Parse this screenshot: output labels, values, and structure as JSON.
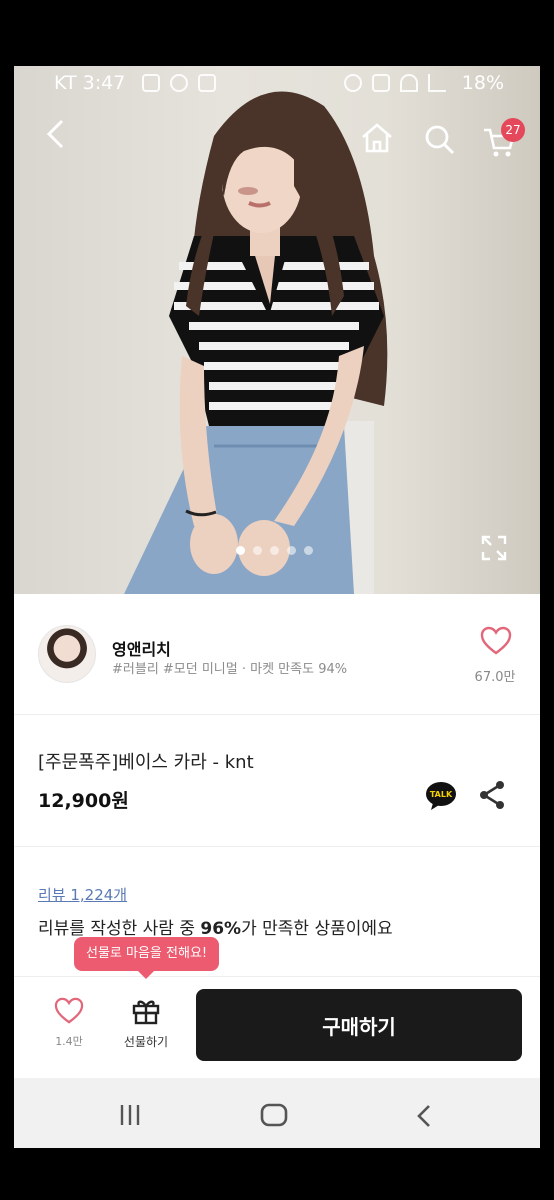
{
  "status_bar": {
    "carrier_time": "KT 3:47",
    "battery": "18%"
  },
  "header": {
    "cart_count": "27"
  },
  "gallery": {
    "slide_count": 5,
    "active_index": 0
  },
  "seller": {
    "name": "영앤리치",
    "tags": "#러블리 #모던 미니멀 · 마켓 만족도 94%",
    "likes": "67.0만"
  },
  "product": {
    "title": "[주문폭주]베이스 카라 - knt",
    "price": "12,900원",
    "talk_label": "TALK"
  },
  "reviews": {
    "link": "리뷰 1,224개",
    "summary_pre": "리뷰를 작성한 사람 중 ",
    "summary_pct": "96%",
    "summary_post": "가 만족한 상품이에요"
  },
  "bottom_bar": {
    "gift_bubble": "선물로 마음을 전해요!",
    "wish_count": "1.4만",
    "gift_label": "선물하기",
    "buy_label": "구매하기"
  },
  "colors": {
    "accent": "#ec5b6f",
    "buy_button": "#1a1a1a"
  }
}
